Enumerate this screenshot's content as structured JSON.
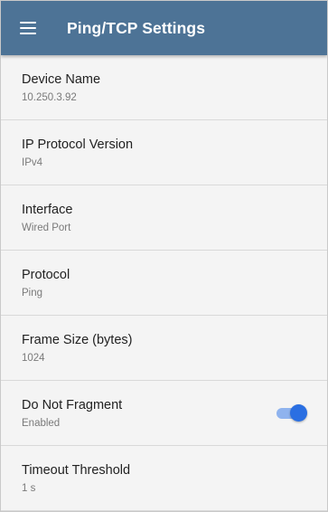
{
  "app_bar": {
    "title": "Ping/TCP Settings",
    "menu_icon": "hamburger-menu-icon",
    "background_color": "#4d7396"
  },
  "settings": [
    {
      "label": "Device Name",
      "value": "10.250.3.92"
    },
    {
      "label": "IP Protocol Version",
      "value": "IPv4"
    },
    {
      "label": "Interface",
      "value": "Wired Port"
    },
    {
      "label": "Protocol",
      "value": "Ping"
    },
    {
      "label": "Frame Size (bytes)",
      "value": "1024"
    },
    {
      "label": "Do Not Fragment",
      "value": "Enabled",
      "toggle_on": true
    },
    {
      "label": "Timeout Threshold",
      "value": "1 s"
    }
  ],
  "toggle_color": "#2a6fe2"
}
